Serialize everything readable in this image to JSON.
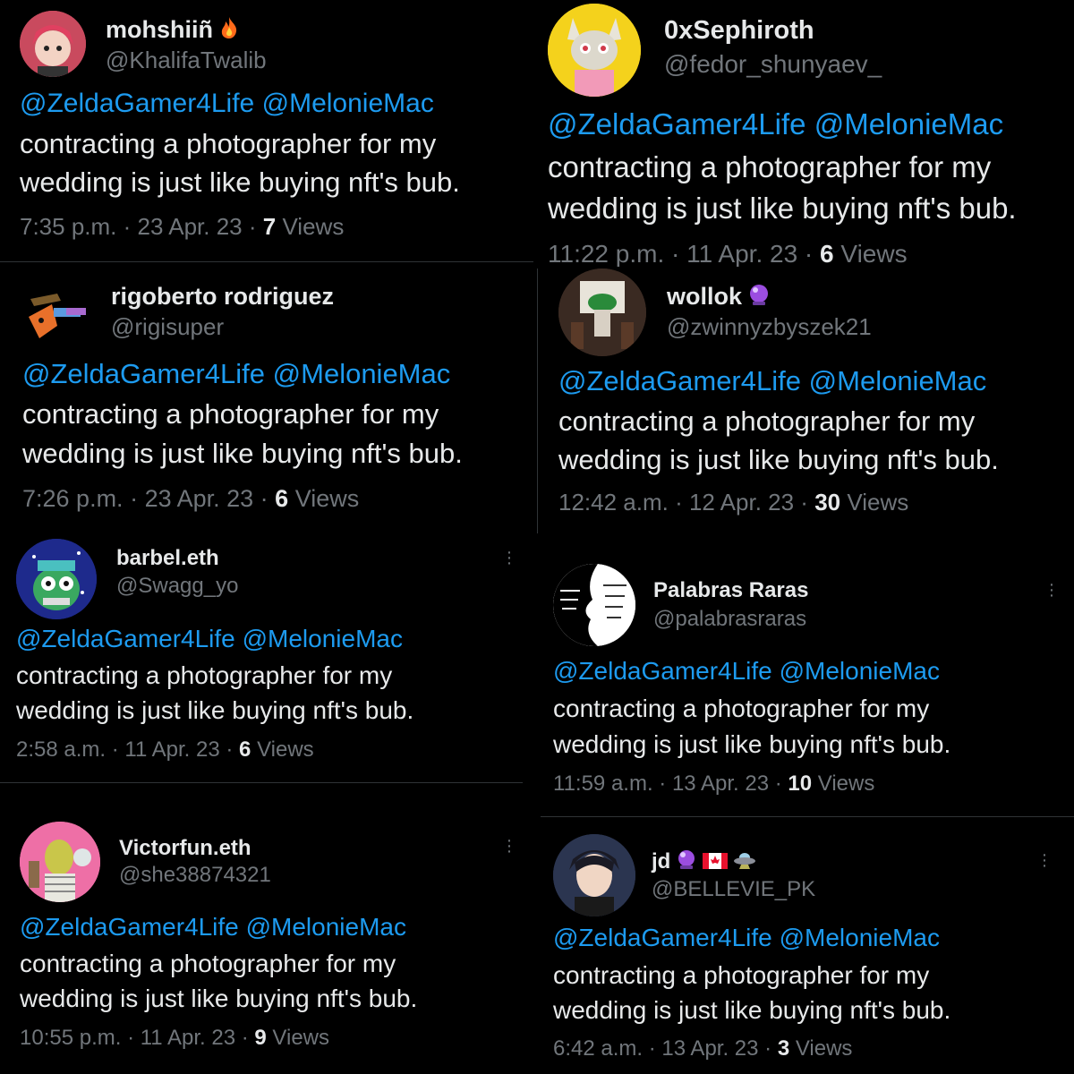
{
  "tweets": [
    {
      "name": "mohshiiñ",
      "handle": "@KhalifaTwalib",
      "mention1": "@ZeldaGamer4Life",
      "mention2": "@MelonieMac",
      "line1": "contracting a photographer for my",
      "line2": "wedding is just like buying nft's bub.",
      "time": "7:35 p.m.",
      "date": "23 Apr. 23",
      "views": "7",
      "views_label": "Views",
      "badge": "fire-icon",
      "avatar_bg": "#c94a5e"
    },
    {
      "name": "0xSephiroth",
      "handle": "@fedor_shunyaev_",
      "mention1": "@ZeldaGamer4Life",
      "mention2": "@MelonieMac",
      "line1": "contracting a photographer for my",
      "line2": "wedding is just like buying nft's bub.",
      "time": "11:22 p.m.",
      "date": "11 Apr. 23",
      "views": "6",
      "views_label": "Views",
      "badge": "",
      "avatar_bg": "#f4d21c"
    },
    {
      "name": "rigoberto rodriguez",
      "handle": "@rigisuper",
      "mention1": "@ZeldaGamer4Life",
      "mention2": "@MelonieMac",
      "line1": "contracting a photographer for my",
      "line2": "wedding is just like buying nft's bub.",
      "time": "7:26 p.m.",
      "date": "23 Apr. 23",
      "views": "6",
      "views_label": "Views",
      "badge": "",
      "avatar_bg": "#1a1a1a"
    },
    {
      "name": "wollok",
      "handle": "@zwinnyzbyszek21",
      "mention1": "@ZeldaGamer4Life",
      "mention2": "@MelonieMac",
      "line1": "contracting a photographer for my",
      "line2": "wedding is just like buying nft's bub.",
      "time": "12:42 a.m.",
      "date": "12 Apr. 23",
      "views": "30",
      "views_label": "Views",
      "badge": "crystal-ball-icon",
      "avatar_bg": "#3a2a22"
    },
    {
      "name": "barbel.eth",
      "handle": "@Swagg_yo",
      "mention1": "@ZeldaGamer4Life",
      "mention2": "@MelonieMac",
      "line1": "contracting a photographer for my",
      "line2": "wedding is just like buying nft's bub.",
      "time": "2:58 a.m.",
      "date": "11 Apr. 23",
      "views": "6",
      "views_label": "Views",
      "badge": "",
      "avatar_bg": "#1e2a8c"
    },
    {
      "name": "Palabras Raras",
      "handle": "@palabrasraras",
      "mention1": "@ZeldaGamer4Life",
      "mention2": "@MelonieMac",
      "line1": "contracting a photographer for my",
      "line2": "wedding is just like buying nft's bub.",
      "time": "11:59 a.m.",
      "date": "13 Apr. 23",
      "views": "10",
      "views_label": "Views",
      "badge": "",
      "avatar_bg": "#ffffff"
    },
    {
      "name": "Victorfun.eth",
      "handle": "@she38874321",
      "mention1": "@ZeldaGamer4Life",
      "mention2": "@MelonieMac",
      "line1": "contracting a photographer for my",
      "line2": "wedding is just like buying nft's bub.",
      "time": "10:55 p.m.",
      "date": "11 Apr. 23",
      "views": "9",
      "views_label": "Views",
      "badge": "",
      "avatar_bg": "#ee6fa6"
    },
    {
      "name": "jd",
      "handle": "@BELLEVIE_PK",
      "mention1": "@ZeldaGamer4Life",
      "mention2": "@MelonieMac",
      "line1": "contracting a photographer for my",
      "line2": "wedding is just like buying nft's bub.",
      "time": "6:42 a.m.",
      "date": "13 Apr. 23",
      "views": "3",
      "views_label": "Views",
      "badge": "crystal-ball-canada-flag-ufo-icons",
      "avatar_bg": "#2b3550"
    }
  ],
  "colors": {
    "background": "#000000",
    "mention": "#1d9bf0",
    "secondary": "#71767b",
    "text": "#e7e9ea"
  }
}
